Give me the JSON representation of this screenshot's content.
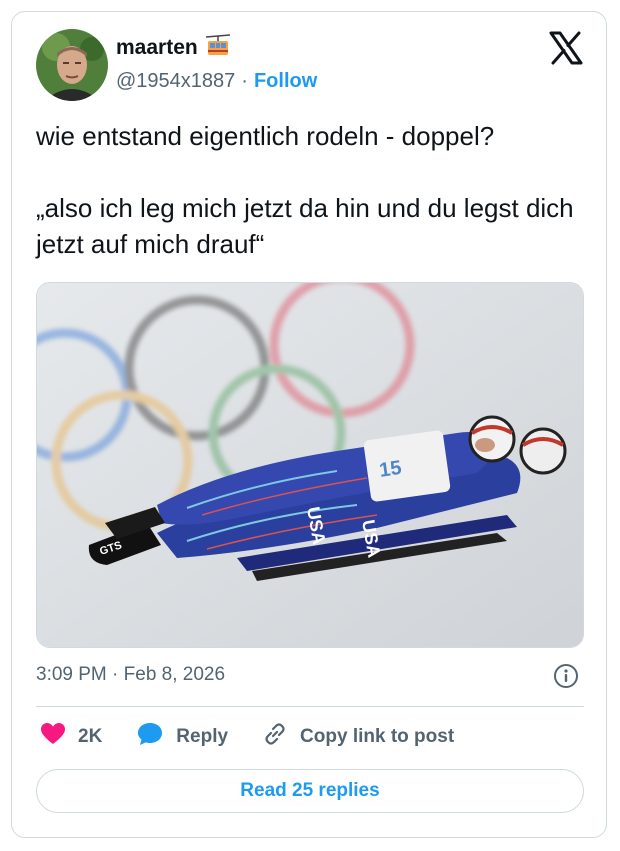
{
  "author": {
    "display_name": "maarten",
    "name_emoji_icon": "aerial-tramway-icon",
    "handle": "@1954x1887",
    "separator": "·",
    "follow_label": "Follow"
  },
  "tweet": {
    "line1": "wie entstand eigentlich rodeln - doppel?",
    "line2": "„also ich leg mich jetzt da hin und du legst dich jetzt auf mich drauf“",
    "media_text": {
      "bib_number": "15",
      "suit_text_1": "USA",
      "suit_text_2": "USA",
      "boot_text": "GTS"
    }
  },
  "meta": {
    "time": "3:09 PM",
    "separator": "·",
    "date": "Feb 8, 2026"
  },
  "actions": {
    "like_count": "2K",
    "reply_label": "Reply",
    "copy_link_label": "Copy link to post"
  },
  "footer": {
    "read_replies_label": "Read 25 replies"
  },
  "colors": {
    "accent": "#1d9bf0",
    "like": "#f91880",
    "text": "#0f1419",
    "muted": "#536471",
    "border": "#cfd9de",
    "suit": "#2b3f9e"
  }
}
